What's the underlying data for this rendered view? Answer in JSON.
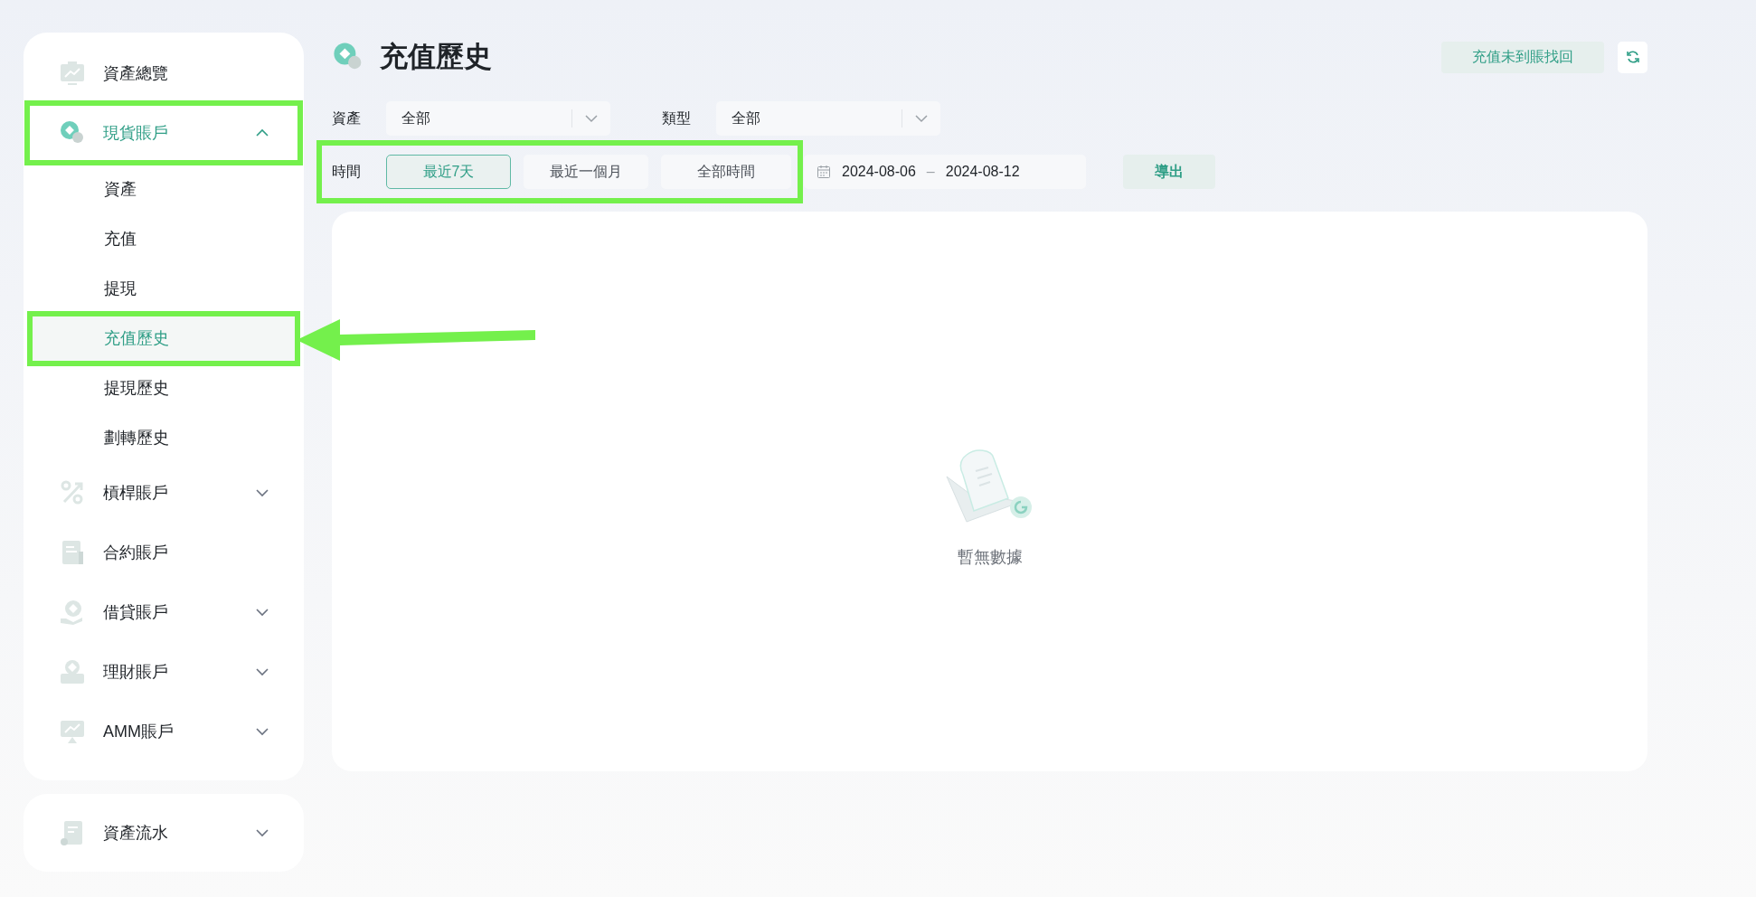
{
  "sidebar": {
    "groups": [
      {
        "items": [
          {
            "label": "資產總覽",
            "kind": "overview",
            "selected": false,
            "highlighted": false
          },
          {
            "label": "現貨賬戶",
            "kind": "spot",
            "expandable": true,
            "expanded": true,
            "selected": true,
            "highlighted": true,
            "children": [
              {
                "label": "資產",
                "selected": false,
                "highlighted": false
              },
              {
                "label": "充值",
                "selected": false,
                "highlighted": false
              },
              {
                "label": "提現",
                "selected": false,
                "highlighted": false
              },
              {
                "label": "充值歷史",
                "selected": true,
                "highlighted": true
              },
              {
                "label": "提現歷史",
                "selected": false,
                "highlighted": false
              },
              {
                "label": "劃轉歷史",
                "selected": false,
                "highlighted": false
              }
            ]
          },
          {
            "label": "槓桿賬戶",
            "kind": "leverage",
            "expandable": true,
            "expanded": false,
            "selected": false,
            "highlighted": false
          },
          {
            "label": "合約賬戶",
            "kind": "contract",
            "selected": false,
            "highlighted": false
          },
          {
            "label": "借貸賬戶",
            "kind": "loan",
            "expandable": true,
            "expanded": false,
            "selected": false,
            "highlighted": false
          },
          {
            "label": "理財賬戶",
            "kind": "finance",
            "expandable": true,
            "expanded": false,
            "selected": false,
            "highlighted": false
          },
          {
            "label": "AMM賬戶",
            "kind": "amm",
            "expandable": true,
            "expanded": false,
            "selected": false,
            "highlighted": false
          }
        ]
      },
      {
        "items": [
          {
            "label": "資產流水",
            "kind": "ledger",
            "expandable": true,
            "expanded": false,
            "selected": false,
            "highlighted": false
          }
        ]
      }
    ]
  },
  "page": {
    "title": "充值歷史",
    "recover_button": "充值未到賬找回"
  },
  "filters": [
    {
      "label": "資產",
      "value": "全部"
    },
    {
      "label": "類型",
      "value": "全部"
    }
  ],
  "time_filter": {
    "label": "時間",
    "highlighted": true,
    "options": [
      {
        "label": "最近7天",
        "selected": true
      },
      {
        "label": "最近一個月",
        "selected": false
      },
      {
        "label": "全部時間",
        "selected": false
      }
    ],
    "start_date": "2024-08-06",
    "separator": "–",
    "end_date": "2024-08-12"
  },
  "export_button": "導出",
  "empty_state": {
    "message": "暫無數據"
  }
}
